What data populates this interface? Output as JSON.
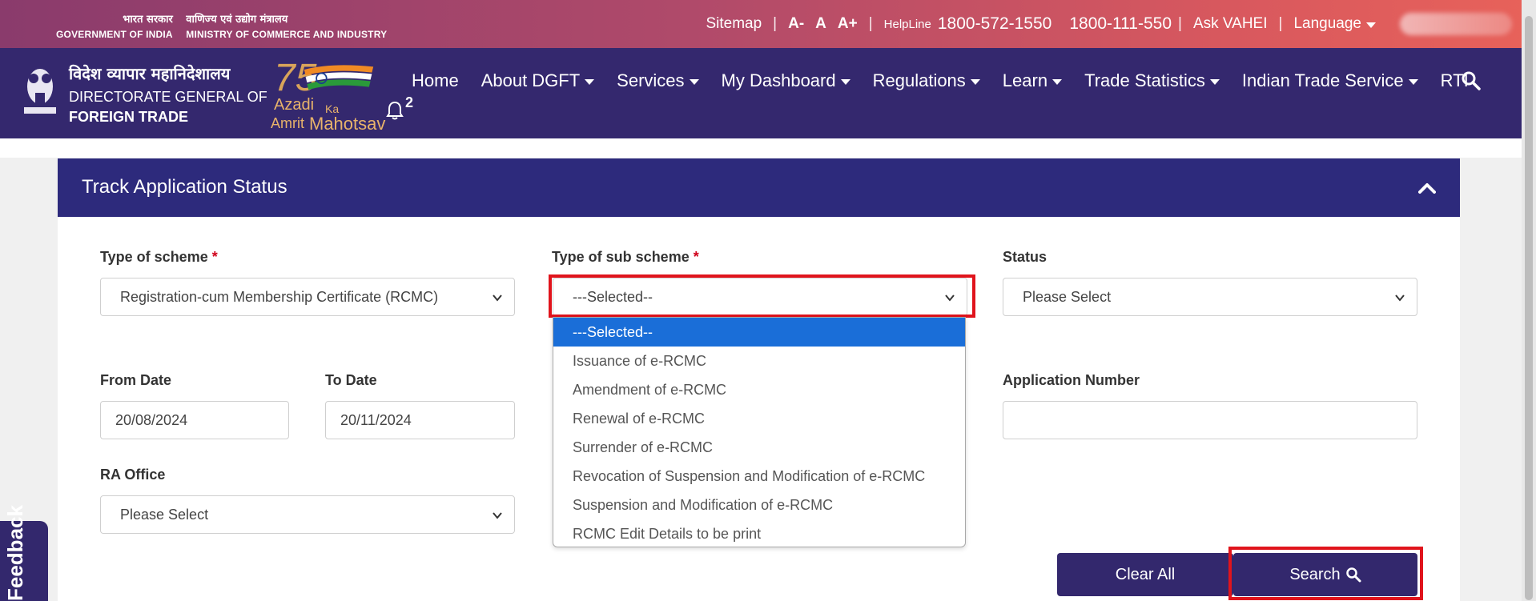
{
  "topbar": {
    "hindi_gov": "भारत सरकार",
    "hindi_ministry": "वाणिज्य एवं उद्योग मंत्रालय",
    "gov_en": "GOVERNMENT OF INDIA",
    "ministry_en": "MINISTRY OF COMMERCE AND INDUSTRY",
    "sitemap": "Sitemap",
    "font_minus": "A-",
    "font_normal": "A",
    "font_plus": "A+",
    "helpline_label": "HelpLine",
    "phone1": "1800-572-1550",
    "phone2": "1800-111-550",
    "ask": "Ask VAHEI",
    "language": "Language",
    "sep": "|"
  },
  "brand": {
    "hindi": "विदेश व्यापार महानिदेशालय",
    "line1": "DIRECTORATE GENERAL OF",
    "line2": "FOREIGN TRADE",
    "azadi_num": "75",
    "azadi1": "Azadi",
    "azadi2": "Ka",
    "azadi3": "Amrit",
    "azadi4": "Mahotsav",
    "notif_count": "2"
  },
  "nav": {
    "home": "Home",
    "about": "About DGFT",
    "services": "Services",
    "dashboard": "My Dashboard",
    "regulations": "Regulations",
    "learn": "Learn",
    "trade_stats": "Trade Statistics",
    "its": "Indian Trade Service",
    "rti": "RTI"
  },
  "panel": {
    "title": "Track Application Status"
  },
  "form": {
    "scheme_label": "Type of scheme",
    "scheme_value": "Registration-cum Membership Certificate (RCMC)",
    "sub_scheme_label": "Type of sub scheme",
    "sub_scheme_value": "---Selected--",
    "status_label": "Status",
    "status_value": "Please Select",
    "from_label": "From Date",
    "from_value": "20/08/2024",
    "to_label": "To Date",
    "to_value": "20/11/2024",
    "appno_label": "Application Number",
    "appno_value": "",
    "ra_label": "RA Office",
    "ra_value": "Please Select",
    "required_mark": "*"
  },
  "dropdown": {
    "options": [
      "---Selected--",
      "Issuance of e-RCMC",
      "Amendment of e-RCMC",
      "Renewal of e-RCMC",
      "Surrender of e-RCMC",
      "Revocation of Suspension and Modification of e-RCMC",
      "Suspension and Modification of e-RCMC",
      "RCMC Edit Details to be print"
    ]
  },
  "buttons": {
    "clear": "Clear All",
    "search": "Search"
  },
  "feedback": "Feedback",
  "colors": {
    "nav_bg": "#34286e",
    "panel_head": "#2d2a7c",
    "highlight": "#e0141c",
    "option_selected": "#1a6ed8"
  }
}
